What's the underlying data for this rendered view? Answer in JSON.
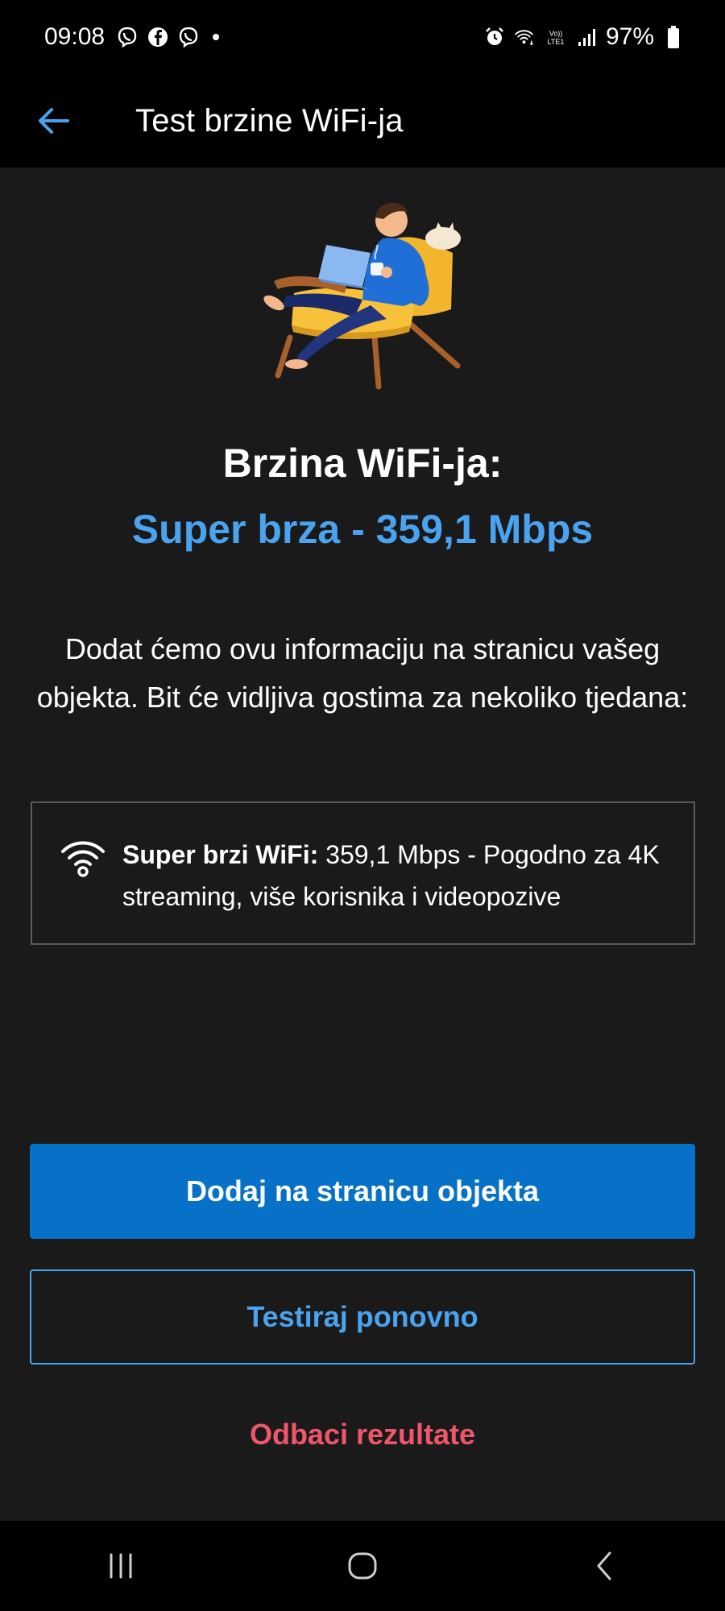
{
  "status_bar": {
    "time": "09:08",
    "battery_percent": "97%",
    "icons": [
      "viber-icon",
      "facebook-icon",
      "viber-icon",
      "notification-dot",
      "alarm-icon",
      "wifi-6-icon",
      "volte-lte-icon",
      "signal-icon",
      "battery-icon"
    ]
  },
  "app_bar": {
    "back_icon": "arrow-left-icon",
    "title": "Test brzine WiFi-ja"
  },
  "result": {
    "heading": "Brzina WiFi-ja:",
    "value": "Super brza - 359,1 Mbps",
    "info": "Dodat ćemo ovu informaciju na stranicu vašeg objekta. Bit će vidljiva gostima za nekoliko tjedana:"
  },
  "info_box": {
    "icon": "wifi-icon",
    "label": "Super brzi WiFi:",
    "text": " 359,1 Mbps - Pogodno za 4K streaming, više korisnika i videopozive"
  },
  "actions": {
    "primary": "Dodaj na stranicu objekta",
    "secondary": "Testiraj ponovno",
    "discard": "Odbaci rezultate"
  },
  "nav_bar": {
    "icons": [
      "recent-apps-icon",
      "home-icon",
      "back-icon"
    ]
  },
  "colors": {
    "accent_blue": "#4aa3ef",
    "primary_button": "#0770c7",
    "discard_red": "#f0566a",
    "background": "#1a1a1a"
  }
}
